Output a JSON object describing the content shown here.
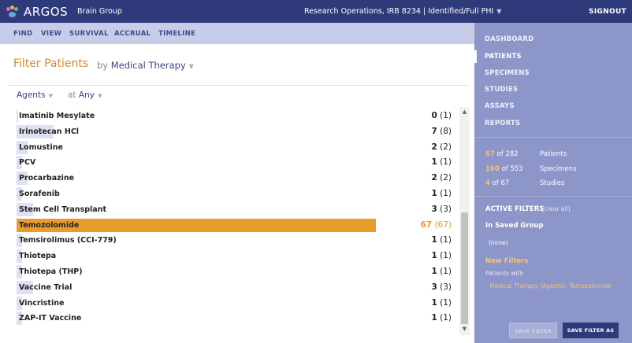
{
  "app": {
    "name": "ARGOS",
    "group": "Brain Group",
    "context": "Research Operations, IRB 8234 | Identified/Full PHI",
    "signout": "SIGNOUT"
  },
  "subnav": [
    "FIND",
    "VIEW",
    "SURVIVAL",
    "ACCRUAL",
    "TIMELINE"
  ],
  "filter": {
    "title": "Filter Patients",
    "by_prefix": "by",
    "by_value": "Medical Therapy",
    "field": "Agents",
    "at_prefix": "at",
    "at_value": "Any"
  },
  "rows": [
    {
      "name": "Imatinib Mesylate",
      "selected": "0",
      "total": "(1)",
      "fraction": 0
    },
    {
      "name": "Irinotecan HCl",
      "selected": "7",
      "total": "(8)",
      "fraction": 0.104
    },
    {
      "name": "Lomustine",
      "selected": "2",
      "total": "(2)",
      "fraction": 0.03
    },
    {
      "name": "PCV",
      "selected": "1",
      "total": "(1)",
      "fraction": 0.015
    },
    {
      "name": "Procarbazine",
      "selected": "2",
      "total": "(2)",
      "fraction": 0.03
    },
    {
      "name": "Sorafenib",
      "selected": "1",
      "total": "(1)",
      "fraction": 0.015
    },
    {
      "name": "Stem Cell Transplant",
      "selected": "3",
      "total": "(3)",
      "fraction": 0.045
    },
    {
      "name": "Temozolomide",
      "selected": "67",
      "total": "(67)",
      "fraction": 1.0,
      "active": true
    },
    {
      "name": "Temsirolimus (CCI-779)",
      "selected": "1",
      "total": "(1)",
      "fraction": 0.015
    },
    {
      "name": "Thiotepa",
      "selected": "1",
      "total": "(1)",
      "fraction": 0.015
    },
    {
      "name": "Thiotepa (THP)",
      "selected": "1",
      "total": "(1)",
      "fraction": 0.015
    },
    {
      "name": "Vaccine Trial",
      "selected": "3",
      "total": "(3)",
      "fraction": 0.045
    },
    {
      "name": "Vincristine",
      "selected": "1",
      "total": "(1)",
      "fraction": 0.015
    },
    {
      "name": "ZAP-IT Vaccine",
      "selected": "1",
      "total": "(1)",
      "fraction": 0.015
    }
  ],
  "sidebar": {
    "nav": [
      "DASHBOARD",
      "PATIENTS",
      "SPECIMENS",
      "STUDIES",
      "ASSAYS",
      "REPORTS"
    ],
    "active_nav": "PATIENTS",
    "stats": [
      {
        "count": "67",
        "of": "of 282",
        "label": "Patients"
      },
      {
        "count": "160",
        "of": "of 553",
        "label": "Specimens"
      },
      {
        "count": "4",
        "of": "of 67",
        "label": "Studies"
      }
    ],
    "active_filters": "ACTIVE FILTERS",
    "clear_all": "[clear all]",
    "in_saved_group": "In Saved Group",
    "none": "(none)",
    "new_filters": "New Filters",
    "patients_with": "Patients with",
    "filter_desc": "Medical Therapy (Agents): Temozolomide",
    "save_filter": "SAVE FILTER",
    "save_filter_as": "SAVE FILTER AS"
  },
  "colors": {
    "topbar": "#2f3a7a",
    "subnav": "#c7cde8",
    "sidebar": "#8c96c9",
    "accent": "#e89c2c",
    "bar": "#dde1f3"
  }
}
